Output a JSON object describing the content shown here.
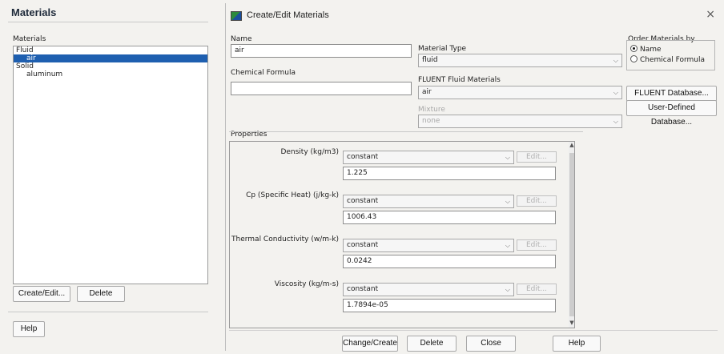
{
  "left_panel": {
    "title": "Materials",
    "list_label": "Materials",
    "list_items": [
      {
        "label": "Fluid",
        "level": 0,
        "selected": false
      },
      {
        "label": "air",
        "level": 1,
        "selected": true
      },
      {
        "label": "Solid",
        "level": 0,
        "selected": false
      },
      {
        "label": "aluminum",
        "level": 1,
        "selected": false
      }
    ],
    "create_edit_label": "Create/Edit...",
    "delete_label": "Delete",
    "help_label": "Help"
  },
  "dialog": {
    "title": "Create/Edit Materials",
    "close_glyph": "×",
    "name_label": "Name",
    "name_value": "air",
    "chemical_formula_label": "Chemical Formula",
    "chemical_formula_value": "",
    "material_type_label": "Material Type",
    "material_type_value": "fluid",
    "fluent_fluid_materials_label": "FLUENT Fluid Materials",
    "fluent_fluid_materials_value": "air",
    "mixture_label": "Mixture",
    "mixture_value": "none",
    "order_by_label": "Order Materials by",
    "order_options": [
      {
        "label": "Name",
        "selected": true
      },
      {
        "label": "Chemical Formula",
        "selected": false
      }
    ],
    "fluent_database_label": "FLUENT Database...",
    "user_defined_database_label": "User-Defined Database...",
    "properties_label": "Properties",
    "properties": [
      {
        "label": "Density (kg/m3)",
        "method": "constant",
        "value": "1.225",
        "edit_label": "Edit..."
      },
      {
        "label": "Cp (Specific Heat) (j/kg-k)",
        "method": "constant",
        "value": "1006.43",
        "edit_label": "Edit..."
      },
      {
        "label": "Thermal Conductivity (w/m-k)",
        "method": "constant",
        "value": "0.0242",
        "edit_label": "Edit..."
      },
      {
        "label": "Viscosity (kg/m-s)",
        "method": "constant",
        "value": "1.7894e-05",
        "edit_label": "Edit..."
      }
    ],
    "buttons": {
      "change_create": "Change/Create",
      "delete": "Delete",
      "close": "Close",
      "help": "Help"
    }
  },
  "colors": {
    "selection": "#1e5fb0",
    "background": "#f3f2ef"
  }
}
